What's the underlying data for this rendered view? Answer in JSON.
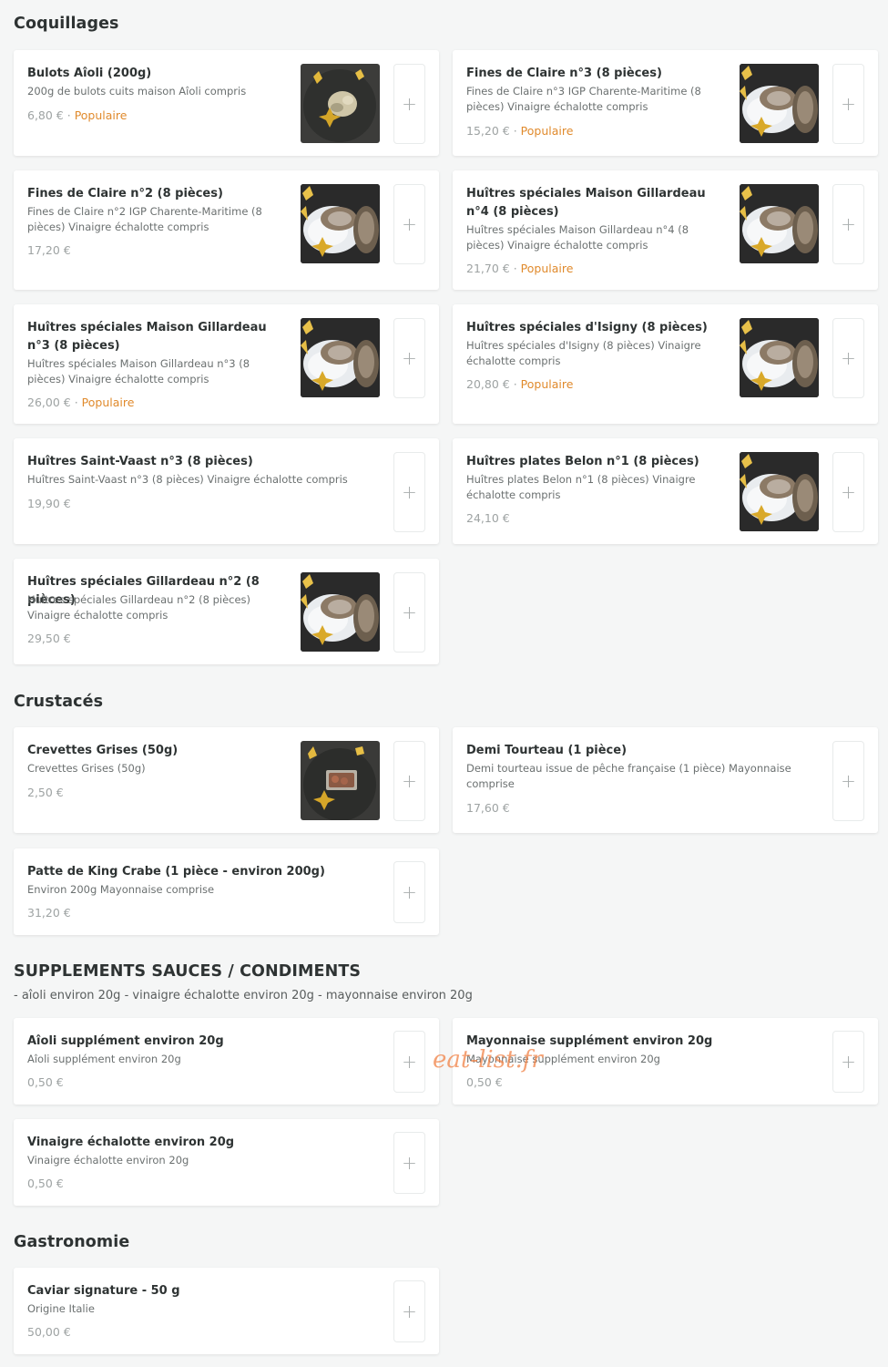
{
  "sections": {
    "coquillages": {
      "title": "Coquillages",
      "items": [
        {
          "name": "Bulots Aîoli (200g)",
          "desc": "200g de bulots cuits maison Aîoli compris",
          "price": "6,80 €",
          "badge": "Populaire",
          "image": "bulots-photo"
        },
        {
          "name": "Fines de Claire n°3 (8 pièces)",
          "desc": "Fines de Claire n°3 IGP Charente-Maritime (8 pièces) Vinaigre échalotte compris",
          "price": "15,20 €",
          "badge": "Populaire",
          "image": "oysters-photo"
        },
        {
          "name": "Fines de Claire n°2 (8 pièces)",
          "desc": "Fines de Claire n°2 IGP Charente-Maritime (8 pièces) Vinaigre échalotte compris",
          "price": "17,20 €",
          "badge": "",
          "image": "oysters-photo"
        },
        {
          "name": "Huîtres spéciales Maison Gillardeau n°4 (8 pièces)",
          "desc": "Huîtres spéciales Maison Gillardeau n°4 (8 pièces) Vinaigre échalotte compris",
          "price": "21,70 €",
          "badge": "Populaire",
          "image": "oysters-photo"
        },
        {
          "name": "Huîtres spéciales Maison Gillardeau n°3 (8 pièces)",
          "desc": "Huîtres spéciales Maison Gillardeau n°3 (8 pièces) Vinaigre échalotte compris",
          "price": "26,00 €",
          "badge": "Populaire",
          "image": "oysters-photo"
        },
        {
          "name": "Huîtres spéciales d'Isigny (8 pièces)",
          "desc": "Huîtres spéciales d'Isigny (8 pièces) Vinaigre échalotte compris",
          "price": "20,80 €",
          "badge": "Populaire",
          "image": "oysters-photo"
        },
        {
          "name": "Huîtres Saint-Vaast n°3 (8 pièces)",
          "desc": "Huîtres Saint-Vaast n°3 (8 pièces) Vinaigre échalotte compris",
          "price": "19,90 €",
          "badge": "",
          "image": ""
        },
        {
          "name": "Huîtres plates Belon n°1 (8 pièces)",
          "desc": "Huîtres plates Belon n°1 (8 pièces) Vinaigre échalotte compris",
          "price": "24,10 €",
          "badge": "",
          "image": "oysters-photo"
        },
        {
          "name": "Huîtres spéciales Gillardeau n°2 (8 pièces)",
          "desc": "Huîtres spéciales Gillardeau n°2 (8 pièces) Vinaigre échalotte compris",
          "price": "29,50 €",
          "badge": "",
          "image": "oysters-photo"
        }
      ]
    },
    "crustaces": {
      "title": "Crustacés",
      "items": [
        {
          "name": "Crevettes Grises (50g)",
          "desc": "Crevettes Grises (50g)",
          "price": "2,50 €",
          "badge": "",
          "image": "shrimp-photo"
        },
        {
          "name": "Demi Tourteau (1 pièce)",
          "desc": "Demi tourteau issue de pêche française (1 pièce) Mayonnaise comprise",
          "price": "17,60 €",
          "badge": "",
          "image": ""
        },
        {
          "name": "Patte de King Crabe (1 pièce - environ 200g)",
          "desc": "Environ 200g Mayonnaise comprise",
          "price": "31,20 €",
          "badge": "",
          "image": ""
        }
      ]
    },
    "supplements": {
      "title": "SUPPLEMENTS SAUCES / CONDIMENTS",
      "subtitle": "- aîoli environ 20g - vinaigre échalotte environ 20g - mayonnaise environ 20g",
      "items": [
        {
          "name": "Aîoli supplément environ 20g",
          "desc": "Aîoli supplément environ 20g",
          "price": "0,50 €",
          "badge": "",
          "image": ""
        },
        {
          "name": "Mayonnaise supplément environ 20g",
          "desc": "Mayonnaise supplément environ 20g",
          "price": "0,50 €",
          "badge": "",
          "image": ""
        },
        {
          "name": "Vinaigre échalotte environ 20g",
          "desc": "Vinaigre échalotte environ 20g",
          "price": "0,50 €",
          "badge": "",
          "image": ""
        }
      ]
    },
    "gastronomie": {
      "title": "Gastronomie",
      "items": [
        {
          "name": "Caviar signature - 50 g",
          "desc": "Origine Italie",
          "price": "50,00 €",
          "badge": "",
          "image": ""
        }
      ]
    }
  },
  "add_button_label": "+",
  "badge_separator": " · ",
  "watermark": "eat-list.fr",
  "colors": {
    "background": "#f5f6f6",
    "card": "#ffffff",
    "popular": "#e08a2c",
    "price": "#9ea3a3",
    "text": "#2e3333"
  }
}
